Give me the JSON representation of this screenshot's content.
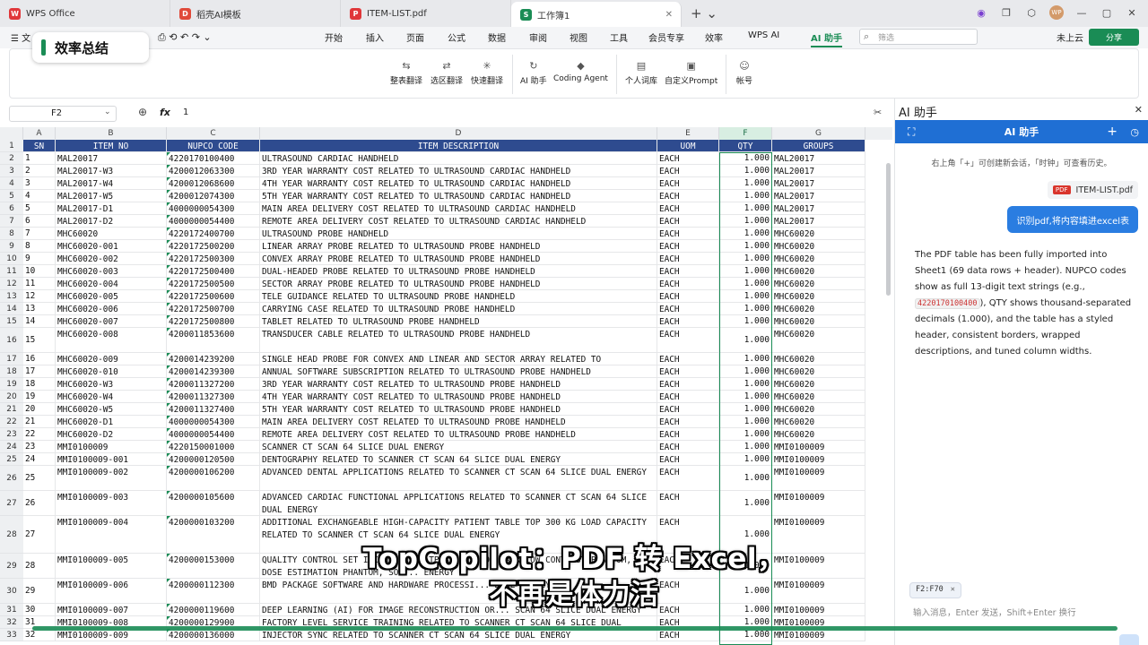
{
  "window_tabs": [
    {
      "label": "WPS Office",
      "icon": "W",
      "color": "#e0373a"
    },
    {
      "label": "稻壳AI模板",
      "icon": "D",
      "color": "#e04a3a"
    },
    {
      "label": "ITEM-LIST.pdf",
      "icon": "P",
      "color": "#e0373a"
    },
    {
      "label": "工作簿1",
      "icon": "S",
      "color": "#1a8c55"
    }
  ],
  "window_controls": {
    "minimize": "—",
    "maximize": "▢",
    "close": "✕"
  },
  "menu": {
    "file": "☰ 文",
    "items": [
      "开始",
      "插入",
      "页面",
      "公式",
      "数据",
      "审阅",
      "视图",
      "工具",
      "会员专享",
      "效率",
      "WPS AI",
      "AI 助手"
    ],
    "search_placeholder": "筛选",
    "cloud": "未上云",
    "share": "分享"
  },
  "overlay_title": "效率总结",
  "ribbon": [
    {
      "icon": "⇆",
      "label": "整表翻译"
    },
    {
      "icon": "⇄",
      "label": "选区翻译"
    },
    {
      "icon": "✳",
      "label": "快速翻译"
    },
    {
      "icon": "↻",
      "label": "AI 助手"
    },
    {
      "icon": "◆",
      "label": "Coding Agent"
    },
    {
      "icon": "▤",
      "label": "个人词库"
    },
    {
      "icon": "▣",
      "label": "自定义Prompt"
    },
    {
      "icon": "☺",
      "label": "帐号"
    }
  ],
  "formula": {
    "cell_ref": "F2",
    "fx": "fx",
    "value": "1"
  },
  "columns": [
    "A",
    "B",
    "C",
    "D",
    "E",
    "F",
    "G"
  ],
  "sheet": {
    "header": [
      "SN",
      "ITEM NO",
      "NUPCO CODE",
      "ITEM DESCRIPTION",
      "UOM",
      "QTY",
      "GROUPS"
    ],
    "rows": [
      [
        "1",
        "MAL20017",
        "4220170100400",
        "ULTRASOUND CARDIAC HANDHELD",
        "EACH",
        "1.000",
        "MAL20017"
      ],
      [
        "2",
        "MAL20017-W3",
        "4200012063300",
        "3RD YEAR WARRANTY COST RELATED TO ULTRASOUND CARDIAC HANDHELD",
        "EACH",
        "1.000",
        "MAL20017"
      ],
      [
        "3",
        "MAL20017-W4",
        "4200012068600",
        "4TH YEAR WARRANTY COST RELATED TO ULTRASOUND CARDIAC HANDHELD",
        "EACH",
        "1.000",
        "MAL20017"
      ],
      [
        "4",
        "MAL20017-W5",
        "4200012074300",
        "5TH YEAR WARRANTY COST RELATED TO ULTRASOUND CARDIAC HANDHELD",
        "EACH",
        "1.000",
        "MAL20017"
      ],
      [
        "5",
        "MAL20017-D1",
        "4000000054300",
        "MAIN AREA DELIVERY COST RELATED TO ULTRASOUND CARDIAC HANDHELD",
        "EACH",
        "1.000",
        "MAL20017"
      ],
      [
        "6",
        "MAL20017-D2",
        "4000000054400",
        "REMOTE AREA DELIVERY COST RELATED TO ULTRASOUND CARDIAC HANDHELD",
        "EACH",
        "1.000",
        "MAL20017"
      ],
      [
        "7",
        "MHC60020",
        "4220172400700",
        "ULTRASOUND PROBE HANDHELD",
        "EACH",
        "1.000",
        "MHC60020"
      ],
      [
        "8",
        "MHC60020-001",
        "4220172500200",
        "LINEAR ARRAY PROBE RELATED TO ULTRASOUND PROBE HANDHELD",
        "EACH",
        "1.000",
        "MHC60020"
      ],
      [
        "9",
        "MHC60020-002",
        "4220172500300",
        "CONVEX ARRAY PROBE RELATED TO ULTRASOUND PROBE HANDHELD",
        "EACH",
        "1.000",
        "MHC60020"
      ],
      [
        "10",
        "MHC60020-003",
        "4220172500400",
        "DUAL-HEADED PROBE RELATED TO ULTRASOUND PROBE HANDHELD",
        "EACH",
        "1.000",
        "MHC60020"
      ],
      [
        "11",
        "MHC60020-004",
        "4220172500500",
        "SECTOR ARRAY PROBE RELATED TO ULTRASOUND PROBE HANDHELD",
        "EACH",
        "1.000",
        "MHC60020"
      ],
      [
        "12",
        "MHC60020-005",
        "4220172500600",
        "TELE GUIDANCE RELATED TO ULTRASOUND PROBE HANDHELD",
        "EACH",
        "1.000",
        "MHC60020"
      ],
      [
        "13",
        "MHC60020-006",
        "4220172500700",
        "CARRYING CASE RELATED TO ULTRASOUND PROBE HANDHELD",
        "EACH",
        "1.000",
        "MHC60020"
      ],
      [
        "14",
        "MHC60020-007",
        "4220172500800",
        "TABLET RELATED TO ULTRASOUND PROBE HANDHELD",
        "EACH",
        "1.000",
        "MHC60020"
      ],
      [
        "15",
        "MHC60020-008",
        "4200011853600",
        "TRANSDUCER CABLE RELATED TO ULTRASOUND PROBE HANDHELD",
        "EACH",
        "1.000",
        "MHC60020"
      ],
      [
        "16",
        "MHC60020-009",
        "4200014239200",
        "SINGLE HEAD PROBE FOR CONVEX AND LINEAR AND SECTOR ARRAY RELATED TO ULTRASOUND PROBE HANDHELD",
        "EACH",
        "1.000",
        "MHC60020"
      ],
      [
        "17",
        "MHC60020-010",
        "4200014239300",
        "ANNUAL SOFTWARE SUBSCRIPTION RELATED TO ULTRASOUND PROBE HANDHELD",
        "EACH",
        "1.000",
        "MHC60020"
      ],
      [
        "18",
        "MHC60020-W3",
        "4200011327200",
        "3RD YEAR WARRANTY COST RELATED TO ULTRASOUND PROBE HANDHELD",
        "EACH",
        "1.000",
        "MHC60020"
      ],
      [
        "19",
        "MHC60020-W4",
        "4200011327300",
        "4TH YEAR WARRANTY COST RELATED TO ULTRASOUND PROBE HANDHELD",
        "EACH",
        "1.000",
        "MHC60020"
      ],
      [
        "20",
        "MHC60020-W5",
        "4200011327400",
        "5TH YEAR WARRANTY COST RELATED TO ULTRASOUND PROBE HANDHELD",
        "EACH",
        "1.000",
        "MHC60020"
      ],
      [
        "21",
        "MHC60020-D1",
        "4000000054300",
        "MAIN AREA DELIVERY COST RELATED TO ULTRASOUND PROBE HANDHELD",
        "EACH",
        "1.000",
        "MHC60020"
      ],
      [
        "22",
        "MHC60020-D2",
        "4000000054400",
        "REMOTE AREA DELIVERY COST RELATED TO ULTRASOUND PROBE HANDHELD",
        "EACH",
        "1.000",
        "MHC60020"
      ],
      [
        "23",
        "MMI0100009",
        "4220150001000",
        "SCANNER CT SCAN 64 SLICE DUAL ENERGY",
        "EACH",
        "1.000",
        "MMI0100009"
      ],
      [
        "24",
        "MMI0100009-001",
        "4200000120500",
        "DENTOGRAPHY RELATED TO SCANNER CT SCAN 64 SLICE DUAL ENERGY",
        "EACH",
        "1.000",
        "MMI0100009"
      ],
      [
        "25",
        "MMI0100009-002",
        "4200000106200",
        "ADVANCED DENTAL APPLICATIONS RELATED TO SCANNER CT SCAN 64 SLICE DUAL ENERGY",
        "EACH",
        "1.000",
        "MMI0100009"
      ],
      [
        "26",
        "MMI0100009-003",
        "4200000105600",
        "ADVANCED CARDIAC FUNCTIONAL APPLICATIONS RELATED TO SCANNER CT SCAN 64 SLICE DUAL ENERGY",
        "EACH",
        "1.000",
        "MMI0100009"
      ],
      [
        "27",
        "MMI0100009-004",
        "4200000103200",
        "ADDITIONAL EXCHANGEABLE HIGH-CAPACITY PATIENT TABLE TOP 300 KG LOAD CAPACITY RELATED TO SCANNER CT SCAN 64 SLICE DUAL ENERGY",
        "EACH",
        "1.000",
        "MMI0100009"
      ],
      [
        "28",
        "MMI0100009-005",
        "4200000153000",
        "QUALITY CONTROL SET INCLUDING: CATPHAN PHANTOM, ACR LOW CONTRAST PHANTOM, DOSE ESTIMATION PHANTOM, SOL... ENERGY",
        "EACH",
        "1.000",
        "MMI0100009"
      ],
      [
        "29",
        "MMI0100009-006",
        "4200000112300",
        "BMD PACKAGE SOFTWARE AND HARDWARE PROCESSI... DUAL ENERGY",
        "EACH",
        "1.000",
        "MMI0100009"
      ],
      [
        "30",
        "MMI0100009-007",
        "4200000119600",
        "DEEP LEARNING (AI) FOR IMAGE RECONSTRUCTION OR... SCAN 64 SLICE DUAL ENERGY",
        "EACH",
        "1.000",
        "MMI0100009"
      ],
      [
        "31",
        "MMI0100009-008",
        "4200000129900",
        "FACTORY LEVEL SERVICE TRAINING RELATED TO SCANNER CT SCAN 64 SLICE DUAL ENERGY",
        "EACH",
        "1.000",
        "MMI0100009"
      ],
      [
        "32",
        "MMI0100009-009",
        "4200000136000",
        "INJECTOR SYNC RELATED TO SCANNER CT SCAN 64 SLICE DUAL ENERGY",
        "EACH",
        "1.000",
        "MMI0100009"
      ]
    ]
  },
  "ai_panel": {
    "top_label": "AI 助手",
    "title": "AI 助手",
    "hint": "右上角「+」可创建新会话，「时钟」可查看历史。",
    "attachment": "ITEM-LIST.pdf",
    "attachment_badge": "PDF",
    "user_message": "识别pdf,将内容填进excel表",
    "response_1": "The PDF table has been fully imported into Sheet1 (69 data rows + header). NUPCO codes show as full 13-digit text strings (e.g., ",
    "response_code": "4220170100400",
    "response_2": "), QTY shows thousand-separated decimals (1.000), and the table has a styled header, consistent borders, wrapped descriptions, and tuned column widths.",
    "context_chip": "F2:F70",
    "input_placeholder": "输入消息，Enter 发送，Shift+Enter 换行"
  },
  "subtitle": {
    "line1": "TopCopilot：PDF 转 Excel，",
    "line2": "不再是体力活"
  }
}
